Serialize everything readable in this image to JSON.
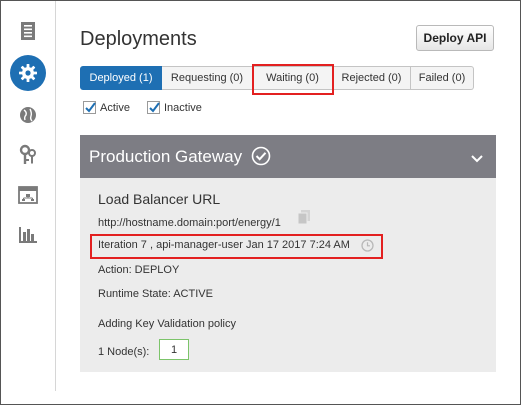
{
  "sidebar": {
    "items": [
      {
        "icon": "document-list-icon",
        "active": false
      },
      {
        "icon": "gear-icon",
        "active": true
      },
      {
        "icon": "globe-icon",
        "active": false
      },
      {
        "icon": "keys-icon",
        "active": false
      },
      {
        "icon": "topology-icon",
        "active": false
      },
      {
        "icon": "bar-chart-icon",
        "active": false
      }
    ],
    "accent": "#1e6fb3"
  },
  "header": {
    "title": "Deployments",
    "deploy_button": "Deploy API"
  },
  "tabs": [
    {
      "label": "Deployed (1)",
      "selected": true
    },
    {
      "label": "Requesting (0)",
      "selected": false
    },
    {
      "label": "Waiting (0)",
      "selected": false
    },
    {
      "label": "Rejected (0)",
      "selected": false
    },
    {
      "label": "Failed (0)",
      "selected": false
    }
  ],
  "filters": [
    {
      "label": "Active",
      "checked": true
    },
    {
      "label": "Inactive",
      "checked": true
    }
  ],
  "gateway": {
    "name": "Production Gateway",
    "load_balancer_title": "Load Balancer URL",
    "url": "http://hostname.domain:port/energy/1",
    "iteration": "Iteration 7 , api-manager-user  Jan 17 2017 7:24 AM",
    "action": "Action: DEPLOY",
    "runtime_state": "Runtime State: ACTIVE",
    "policy_status": "Adding Key Validation policy",
    "nodes_label": "1 Node(s):",
    "nodes_value": "1"
  },
  "colors": {
    "highlight": "#e32020",
    "gateway_header": "#7d7d84",
    "gateway_body": "#ececec"
  }
}
